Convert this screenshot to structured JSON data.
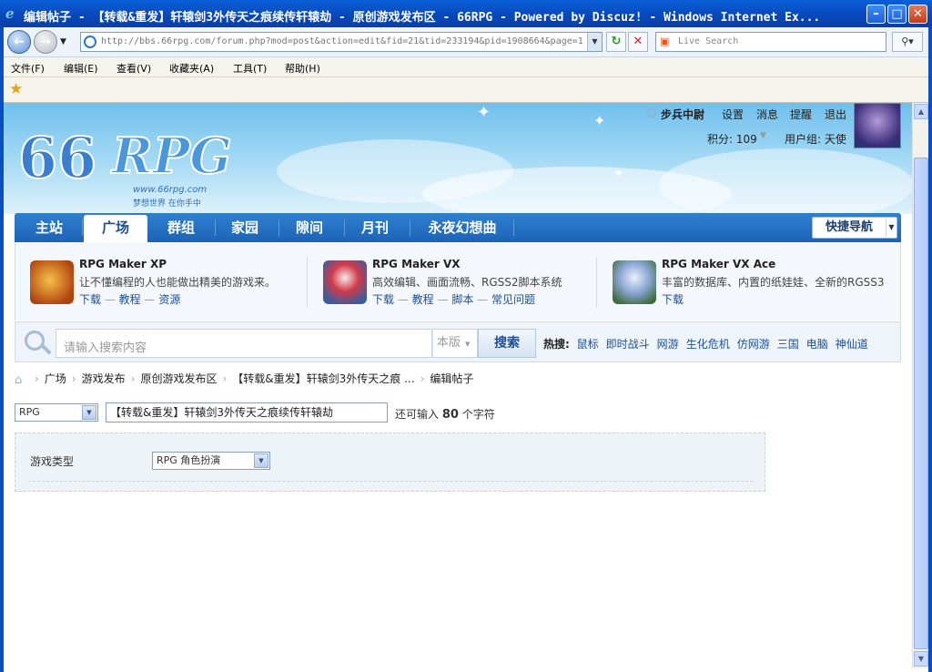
{
  "window": {
    "title": "编辑帖子 - 【转载&重发】轩辕剑3外传天之痕续传轩辕劫 - 原创游戏发布区 - 66RPG - Powered by Discuz! - Windows Internet Ex...",
    "minimize": "–",
    "maximize": "□",
    "close": "✕"
  },
  "addressbar": {
    "url": "http://bbs.66rpg.com/forum.php?mod=post&action=edit&fid=21&tid=233194&pid=1908664&page=1",
    "search_placeholder": "Live Search"
  },
  "menu": [
    "文件(F)",
    "编辑(E)",
    "查看(V)",
    "收藏夹(A)",
    "工具(T)",
    "帮助(H)"
  ],
  "header": {
    "logo_number": "66",
    "logo_text": "RPG",
    "logo_site": "www.66rpg.com",
    "logo_slogan": "梦想世界 在你手中",
    "user": {
      "name": "步兵中尉",
      "links": [
        "设置",
        "消息",
        "提醒",
        "退出"
      ],
      "points_label": "积分: 109",
      "group_label": "用户组: 天使"
    }
  },
  "nav": {
    "items": [
      "主站",
      "广场",
      "群组",
      "家园",
      "隙间",
      "月刊",
      "永夜幻想曲"
    ],
    "active": "广场",
    "quick_nav": "快捷导航"
  },
  "products": [
    {
      "name": "RPG Maker XP",
      "desc": "让不懂编程的人也能做出精美的游戏来。",
      "links": [
        "下载",
        "教程",
        "资源"
      ]
    },
    {
      "name": "RPG Maker VX",
      "desc": "高效编辑、画面流畅、RGSS2脚本系统",
      "links": [
        "下载",
        "教程",
        "脚本",
        "常见问题"
      ]
    },
    {
      "name": "RPG Maker VX Ace",
      "desc": "丰富的数据库、内置的纸娃娃、全新的RGSS3",
      "links": [
        "下载"
      ]
    }
  ],
  "search": {
    "placeholder": "请输入搜索内容",
    "scope": "本版",
    "button": "搜索",
    "hot_label": "热搜:",
    "hot": [
      "鼠标",
      "即时战斗",
      "网游",
      "生化危机",
      "仿网游",
      "三国",
      "电脑",
      "神仙道"
    ]
  },
  "breadcrumb": [
    "广场",
    "游戏发布",
    "原创游戏发布区",
    "【转载&重发】轩辕剑3外传天之痕 ...",
    "编辑帖子"
  ],
  "form": {
    "category": "RPG",
    "title_value": "【转载&重发】轩辕剑3外传天之痕续传轩辕劫",
    "char_prefix": "还可输入",
    "char_count": "80",
    "char_suffix": "个字符",
    "type_label": "游戏类型",
    "type_value": "RPG 角色扮演"
  }
}
